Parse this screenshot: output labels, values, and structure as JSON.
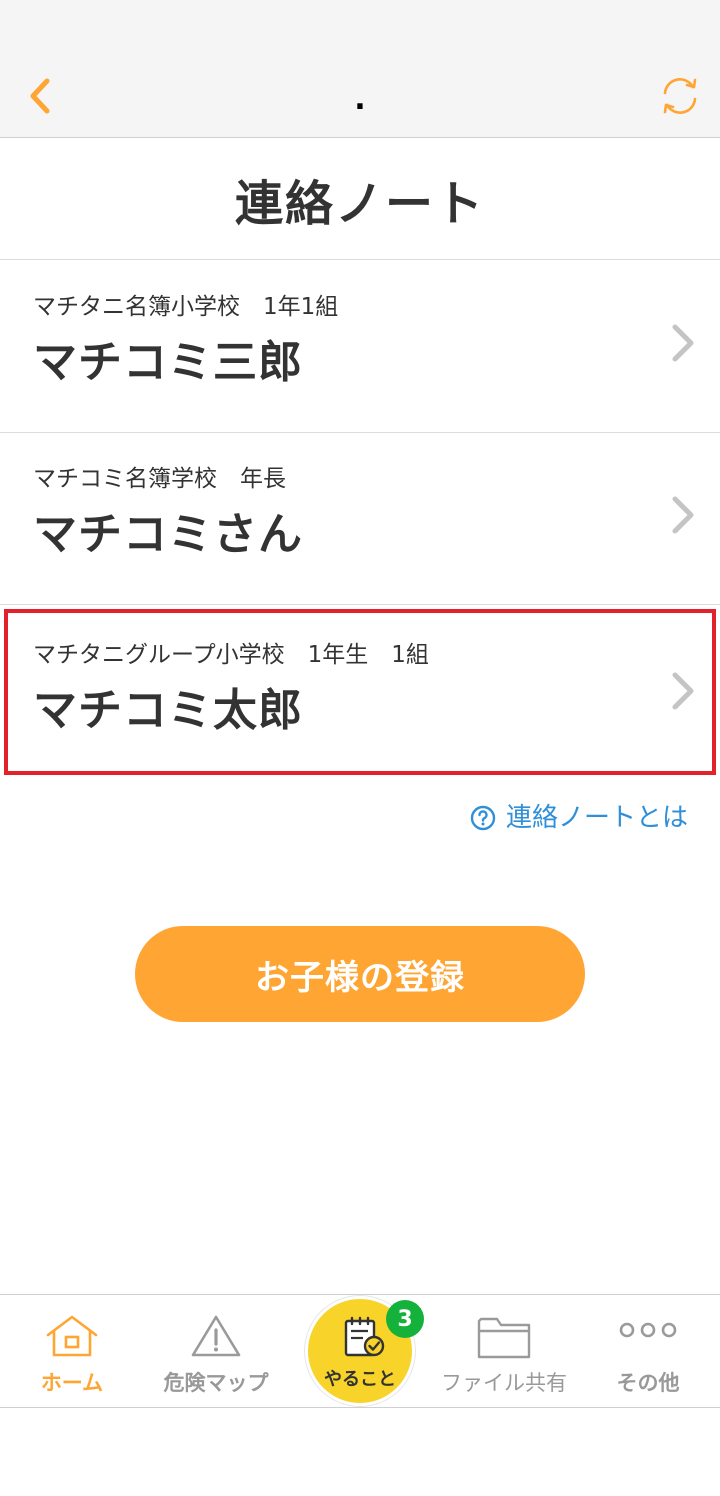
{
  "nav": {
    "title": ".",
    "back_icon": "chevron-left-icon",
    "refresh_icon": "refresh-icon",
    "accent_color": "#ffa534"
  },
  "page": {
    "title": "連絡ノート"
  },
  "children": [
    {
      "school": "マチタニ名簿小学校　1年1組",
      "name": "マチコミ三郎",
      "selected": false
    },
    {
      "school": "マチコミ名簿学校　年長",
      "name": "マチコミさん",
      "selected": false
    },
    {
      "school": "マチタニグループ小学校　1年生　1組",
      "name": "マチコミ太郎",
      "selected": true
    }
  ],
  "help_link": {
    "label": "連絡ノートとは",
    "icon": "question-circle-icon"
  },
  "register_button": {
    "label": "お子様の登録"
  },
  "tab_bar": {
    "home": {
      "label": "ホーム",
      "icon": "home-icon",
      "active": true
    },
    "danger_map": {
      "label": "危険マップ",
      "icon": "warning-icon"
    },
    "todo": {
      "label": "やること",
      "icon": "todo-notepad-icon",
      "badge": "3"
    },
    "file_share": {
      "label": "ファイル共有",
      "icon": "folder-icon"
    },
    "other": {
      "label": "その他",
      "icon": "more-dots-icon"
    }
  },
  "colors": {
    "accent": "#ffa534",
    "link": "#2f8fd8",
    "selection_border": "#e4202a",
    "badge": "#14b23a",
    "todo_button": "#f8d42a"
  }
}
